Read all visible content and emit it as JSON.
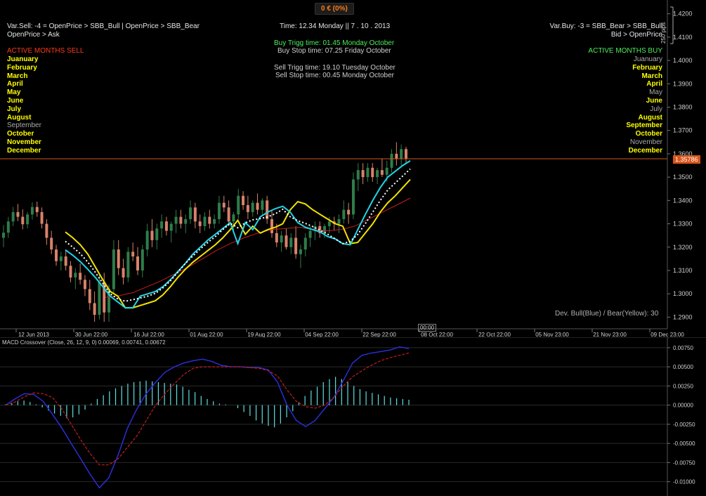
{
  "pnl_badge": "0 € (0%)",
  "header": {
    "var_sell_line1": "Var.Sell: -4 = OpenPrice > SBB_Bull | OpenPrice > SBB_Bear",
    "var_sell_line2": "OpenPrice > Ask",
    "time_line": "Time: 12.34  Monday  ||  7 . 10 . 2013",
    "buy_trigg": "Buy Trigg time: 01.45   Monday  October",
    "buy_stop": "Buy Stop time: 07.25   Friday  October",
    "sell_trigg": "Sell Trigg time: 19.10   Tuesday  October",
    "sell_stop": "Sell Stop time: 00.45   Monday  October",
    "var_buy_line1": "Var.Buy: -3 = SBB_Bear > SBB_Bull",
    "var_buy_line2": "Bid > OpenPrice"
  },
  "active_months_sell": {
    "title": "ACTIVE MONTHS SELL",
    "months": [
      {
        "name": "Juanuary",
        "active": true
      },
      {
        "name": "February",
        "active": true
      },
      {
        "name": "March",
        "active": true
      },
      {
        "name": "April",
        "active": true
      },
      {
        "name": "May",
        "active": true
      },
      {
        "name": "June",
        "active": true
      },
      {
        "name": "July",
        "active": true
      },
      {
        "name": "August",
        "active": true
      },
      {
        "name": "September",
        "active": false
      },
      {
        "name": "October",
        "active": true
      },
      {
        "name": "November",
        "active": true
      },
      {
        "name": "December",
        "active": true
      }
    ]
  },
  "active_months_buy": {
    "title": "ACTIVE MONTHS BUY",
    "months": [
      {
        "name": "Juanuary",
        "active": false
      },
      {
        "name": "February",
        "active": true
      },
      {
        "name": "March",
        "active": true
      },
      {
        "name": "April",
        "active": true
      },
      {
        "name": "May",
        "active": false
      },
      {
        "name": "June",
        "active": true
      },
      {
        "name": "July",
        "active": false
      },
      {
        "name": "August",
        "active": true
      },
      {
        "name": "September",
        "active": true
      },
      {
        "name": "October",
        "active": true
      },
      {
        "name": "November",
        "active": false
      },
      {
        "name": "December",
        "active": true
      }
    ]
  },
  "pips_label": "250 pips",
  "current_price_label": "1.35786",
  "dev_label": "Dev. Bull(Blue) / Bear(Yellow):  30",
  "time_cursor_label": "00:00",
  "macd_title": "MACD Crossover (Close, 26, 12, 9, 0) 0.00069, 0.00741, 0.00672",
  "colors": {
    "bull_candle": "#2e7d4a",
    "bear_candle": "#d9826b",
    "band_bull": "#22d3e6",
    "band_bear": "#f2e200",
    "midline": "#ffffff",
    "ma": "#c41e1e",
    "price_line": "#d8541a",
    "macd_line": "#2f2fe0",
    "signal_line": "#c41e1e",
    "histogram": "#5fe0e0",
    "active_month": "#ffff00",
    "inactive_month": "#a9a9a9",
    "sell_title": "#ff3a1a",
    "buy_title": "#4bf05a",
    "buy_info": "#4bf05a"
  },
  "chart_data": [
    {
      "type": "candlestick",
      "title": "",
      "y_tick_labels": [
        "1.4200",
        "1.4100",
        "1.4000",
        "1.3900",
        "1.3800",
        "1.3700",
        "1.3600",
        "1.3500",
        "1.3400",
        "1.3300",
        "1.3200",
        "1.3100",
        "1.3000",
        "1.2900"
      ],
      "ylim": [
        1.285,
        1.4235
      ],
      "x_tick_labels": [
        "12 Jun 2013",
        "30 Jun 22:00",
        "16 Jul 22:00",
        "01 Aug 22:00",
        "19 Aug 22:00",
        "04 Sep 22:00",
        "22 Sep 22:00",
        "08 Oct 22:00",
        "22 Oct 22:00",
        "05 Nov 23:00",
        "21 Nov 23:00",
        "09 Dec 23:00"
      ],
      "current_price": 1.35786,
      "candles": [
        [
          1.324,
          1.3295,
          1.32,
          1.3262
        ],
        [
          1.3262,
          1.333,
          1.324,
          1.331
        ],
        [
          1.331,
          1.3372,
          1.329,
          1.335
        ],
        [
          1.335,
          1.3385,
          1.3312,
          1.333
        ],
        [
          1.333,
          1.3362,
          1.3276,
          1.3298
        ],
        [
          1.3298,
          1.335,
          1.328,
          1.334
        ],
        [
          1.334,
          1.3392,
          1.3318,
          1.3372
        ],
        [
          1.3372,
          1.3395,
          1.333,
          1.335
        ],
        [
          1.335,
          1.337,
          1.328,
          1.33
        ],
        [
          1.33,
          1.332,
          1.321,
          1.324
        ],
        [
          1.324,
          1.327,
          1.317,
          1.319
        ],
        [
          1.319,
          1.321,
          1.312,
          1.314
        ],
        [
          1.314,
          1.318,
          1.31,
          1.316
        ],
        [
          1.316,
          1.319,
          1.31,
          1.312
        ],
        [
          1.312,
          1.314,
          1.305,
          1.307
        ],
        [
          1.307,
          1.311,
          1.302,
          1.309
        ],
        [
          1.309,
          1.313,
          1.304,
          1.306
        ],
        [
          1.306,
          1.308,
          1.299,
          1.302
        ],
        [
          1.302,
          1.306,
          1.293,
          1.296
        ],
        [
          1.296,
          1.301,
          1.288,
          1.291
        ],
        [
          1.291,
          1.308,
          1.289,
          1.305
        ],
        [
          1.305,
          1.309,
          1.288,
          1.292
        ],
        [
          1.292,
          1.304,
          1.288,
          1.302
        ],
        [
          1.302,
          1.323,
          1.3,
          1.319
        ],
        [
          1.319,
          1.323,
          1.308,
          1.311
        ],
        [
          1.311,
          1.315,
          1.304,
          1.307
        ],
        [
          1.307,
          1.32,
          1.305,
          1.318
        ],
        [
          1.318,
          1.322,
          1.314,
          1.316
        ],
        [
          1.316,
          1.32,
          1.308,
          1.31
        ],
        [
          1.31,
          1.321,
          1.307,
          1.319
        ],
        [
          1.319,
          1.33,
          1.316,
          1.327
        ],
        [
          1.327,
          1.332,
          1.32,
          1.323
        ],
        [
          1.323,
          1.33,
          1.319,
          1.328
        ],
        [
          1.328,
          1.334,
          1.324,
          1.331
        ],
        [
          1.331,
          1.333,
          1.325,
          1.327
        ],
        [
          1.327,
          1.331,
          1.322,
          1.33
        ],
        [
          1.33,
          1.336,
          1.326,
          1.333
        ],
        [
          1.333,
          1.336,
          1.328,
          1.33
        ],
        [
          1.33,
          1.334,
          1.326,
          1.332
        ],
        [
          1.332,
          1.34,
          1.33,
          1.337
        ],
        [
          1.337,
          1.339,
          1.328,
          1.331
        ],
        [
          1.331,
          1.334,
          1.326,
          1.329
        ],
        [
          1.329,
          1.335,
          1.327,
          1.333
        ],
        [
          1.333,
          1.336,
          1.328,
          1.33
        ],
        [
          1.33,
          1.334,
          1.328,
          1.332
        ],
        [
          1.332,
          1.342,
          1.33,
          1.339
        ],
        [
          1.339,
          1.342,
          1.335,
          1.337
        ],
        [
          1.337,
          1.34,
          1.329,
          1.331
        ],
        [
          1.331,
          1.335,
          1.327,
          1.334
        ],
        [
          1.334,
          1.345,
          1.332,
          1.342
        ],
        [
          1.342,
          1.344,
          1.336,
          1.338
        ],
        [
          1.338,
          1.342,
          1.332,
          1.335
        ],
        [
          1.335,
          1.34,
          1.333,
          1.339
        ],
        [
          1.339,
          1.343,
          1.334,
          1.336
        ],
        [
          1.336,
          1.341,
          1.334,
          1.34
        ],
        [
          1.34,
          1.342,
          1.33,
          1.332
        ],
        [
          1.332,
          1.336,
          1.324,
          1.326
        ],
        [
          1.326,
          1.33,
          1.32,
          1.322
        ],
        [
          1.322,
          1.327,
          1.318,
          1.325
        ],
        [
          1.325,
          1.328,
          1.319,
          1.32
        ],
        [
          1.32,
          1.326,
          1.317,
          1.324
        ],
        [
          1.324,
          1.329,
          1.315,
          1.317
        ],
        [
          1.317,
          1.321,
          1.311,
          1.319
        ],
        [
          1.319,
          1.326,
          1.316,
          1.324
        ],
        [
          1.324,
          1.329,
          1.32,
          1.327
        ],
        [
          1.327,
          1.331,
          1.323,
          1.329
        ],
        [
          1.329,
          1.331,
          1.324,
          1.326
        ],
        [
          1.326,
          1.33,
          1.324,
          1.329
        ],
        [
          1.329,
          1.333,
          1.326,
          1.331
        ],
        [
          1.331,
          1.333,
          1.327,
          1.33
        ],
        [
          1.33,
          1.334,
          1.326,
          1.332
        ],
        [
          1.332,
          1.34,
          1.33,
          1.336
        ],
        [
          1.336,
          1.339,
          1.33,
          1.334
        ],
        [
          1.334,
          1.352,
          1.332,
          1.349
        ],
        [
          1.349,
          1.356,
          1.344,
          1.353
        ],
        [
          1.353,
          1.356,
          1.347,
          1.35
        ],
        [
          1.35,
          1.356,
          1.348,
          1.354
        ],
        [
          1.354,
          1.356,
          1.348,
          1.35
        ],
        [
          1.35,
          1.354,
          1.347,
          1.353
        ],
        [
          1.353,
          1.358,
          1.35,
          1.351
        ],
        [
          1.351,
          1.357,
          1.348,
          1.354
        ],
        [
          1.354,
          1.362,
          1.352,
          1.36
        ],
        [
          1.36,
          1.365,
          1.355,
          1.358
        ],
        [
          1.358,
          1.364,
          1.355,
          1.362
        ],
        [
          1.362,
          1.363,
          1.356,
          1.3579
        ]
      ],
      "series": [
        {
          "name": "Bull(Blue)",
          "values": [
            1.3188,
            1.3165,
            1.3138,
            1.3105,
            1.307,
            1.303,
            1.299,
            1.2965,
            1.294,
            1.294,
            1.299,
            1.3,
            1.301,
            1.303,
            1.306,
            1.3095,
            1.313,
            1.317,
            1.32,
            1.323,
            1.3255,
            1.328,
            1.3305,
            1.3215,
            1.3305,
            1.3275,
            1.333,
            1.335,
            1.3365,
            1.3375,
            1.335,
            1.3305,
            1.3285,
            1.3275,
            1.3265,
            1.3245,
            1.3235,
            1.3215,
            1.321,
            1.3275,
            1.334,
            1.34,
            1.3455,
            1.35,
            1.3525,
            1.355,
            1.357
          ]
        },
        {
          "name": "Bear(Yellow)",
          "values": [
            1.3265,
            1.324,
            1.321,
            1.317,
            1.3115,
            1.306,
            1.301,
            1.299,
            1.294,
            1.294,
            1.295,
            1.296,
            1.297,
            1.2995,
            1.303,
            1.307,
            1.3105,
            1.3135,
            1.316,
            1.3185,
            1.321,
            1.324,
            1.3275,
            1.3315,
            1.3255,
            1.329,
            1.326,
            1.3275,
            1.3285,
            1.33,
            1.336,
            1.3395,
            1.3385,
            1.336,
            1.334,
            1.332,
            1.33,
            1.329,
            1.3215,
            1.322,
            1.326,
            1.33,
            1.335,
            1.339,
            1.342,
            1.3455,
            1.349
          ]
        },
        {
          "name": "Mid",
          "values": [
            1.3225,
            1.32,
            1.3172,
            1.3136,
            1.3092,
            1.3045,
            1.3,
            1.2978,
            1.2968,
            1.2975,
            1.2982,
            1.299,
            1.3002,
            1.3025,
            1.3055,
            1.3092,
            1.313,
            1.3162,
            1.3192,
            1.322,
            1.3245,
            1.3275,
            1.3302,
            1.3283,
            1.3304,
            1.3317,
            1.3322,
            1.333,
            1.3343,
            1.3362,
            1.333,
            1.3313,
            1.3302,
            1.3288,
            1.3272,
            1.3255,
            1.3235,
            1.3215,
            1.3225,
            1.3255,
            1.33,
            1.335,
            1.34,
            1.3445,
            1.3475,
            1.3505,
            1.3535
          ]
        },
        {
          "name": "MA",
          "values": [
            1.2985,
            1.2992,
            1.3005,
            1.303,
            1.3055,
            1.3085,
            1.3115,
            1.315,
            1.3185,
            1.3215,
            1.324,
            1.326,
            1.3275,
            1.328,
            1.3285,
            1.3275,
            1.327,
            1.3275,
            1.329,
            1.332,
            1.335,
            1.338,
            1.341
          ]
        }
      ]
    },
    {
      "type": "line",
      "title": "MACD Crossover (Close, 26, 12, 9, 0)",
      "y_tick_labels": [
        "0.00750",
        "0.00500",
        "0.00250",
        "0.00000",
        "-0.00250",
        "-0.00500",
        "-0.00750",
        "-0.01000"
      ],
      "ylim": [
        -0.0115,
        0.0085
      ],
      "histogram": [
        0.0001,
        0.0003,
        0.0005,
        0.0006,
        0.0004,
        0.0001,
        -0.0003,
        -0.0007,
        -0.0011,
        -0.0014,
        -0.0017,
        -0.0016,
        -0.0012,
        -0.0006,
        0.0002,
        0.0008,
        0.0013,
        0.0018,
        0.0022,
        0.0025,
        0.0028,
        0.003,
        0.0031,
        0.0032,
        0.0031,
        0.003,
        0.0029,
        0.0028,
        0.0027,
        0.0024,
        0.002,
        0.0017,
        0.0012,
        0.0008,
        0.0005,
        0.0002,
        0.0001,
        0.0,
        -0.0004,
        -0.0009,
        -0.0014,
        -0.002,
        -0.0024,
        -0.0027,
        -0.0029,
        -0.0024,
        -0.0016,
        -0.0008,
        0.0004,
        0.0012,
        0.0019,
        0.0024,
        0.003,
        0.0034,
        0.0037,
        0.0034,
        0.003,
        0.0025,
        0.0021,
        0.0018,
        0.0016,
        0.0014,
        0.0012,
        0.001,
        0.0009,
        0.0008,
        0.0007
      ],
      "series": [
        {
          "name": "MACD",
          "values": [
            0.0,
            0.0008,
            0.0015,
            0.0014,
            0.0005,
            -0.0012,
            -0.003,
            -0.005,
            -0.007,
            -0.009,
            -0.0108,
            -0.0095,
            -0.0065,
            -0.003,
            -0.0005,
            0.0015,
            0.003,
            0.0043,
            0.005,
            0.0055,
            0.0058,
            0.006,
            0.0057,
            0.0052,
            0.005,
            0.005,
            0.0049,
            0.0049,
            0.0046,
            0.003,
            0.0,
            -0.002,
            -0.0028,
            -0.002,
            -0.0005,
            0.001,
            0.0032,
            0.0055,
            0.0065,
            0.0068,
            0.007,
            0.0072,
            0.0076,
            0.0074
          ]
        },
        {
          "name": "Signal",
          "values": [
            0.0,
            0.0004,
            0.0011,
            0.0016,
            0.0015,
            0.001,
            -0.0005,
            -0.0025,
            -0.0045,
            -0.0063,
            -0.0078,
            -0.0078,
            -0.007,
            -0.0055,
            -0.004,
            -0.002,
            0.0,
            0.0015,
            0.0028,
            0.004,
            0.0048,
            0.005,
            0.005,
            0.005,
            0.005,
            0.005,
            0.0049,
            0.0048,
            0.0045,
            0.0038,
            0.002,
            0.0005,
            -0.0002,
            -0.0004,
            0.0,
            0.001,
            0.0025,
            0.0037,
            0.0045,
            0.0052,
            0.0058,
            0.0062,
            0.0065,
            0.0068
          ]
        }
      ]
    }
  ]
}
